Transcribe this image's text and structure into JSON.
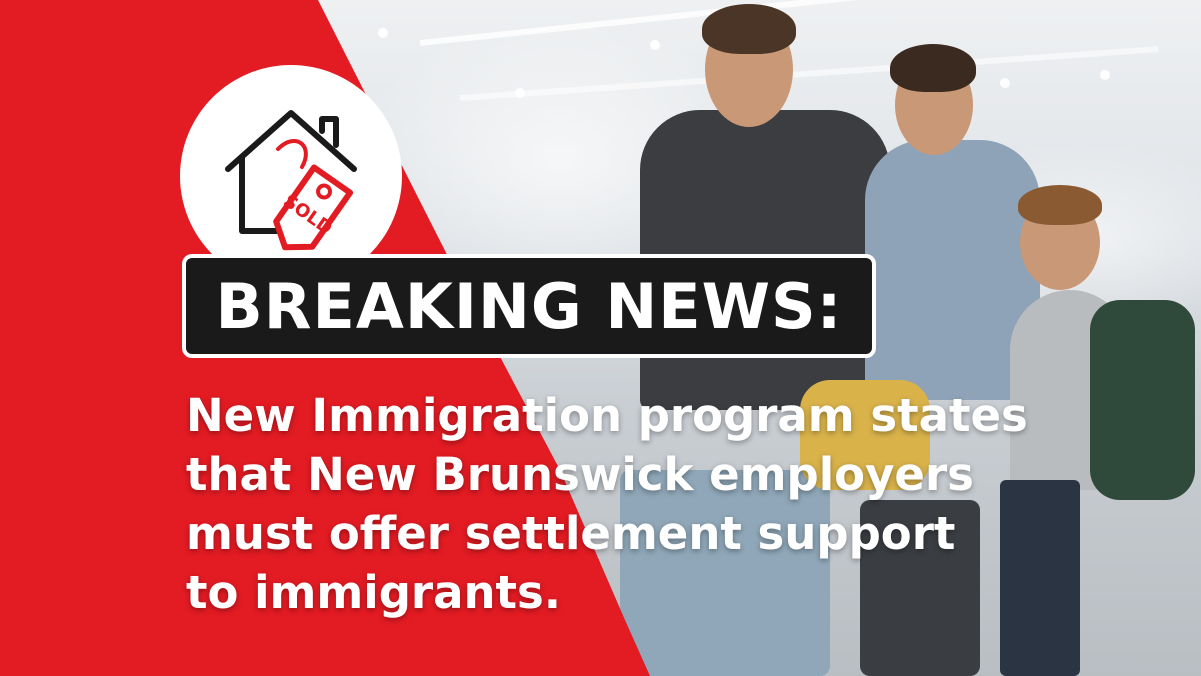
{
  "banner": {
    "title": "BREAKING NEWS:",
    "headline_lines": [
      "New Immigration program states",
      "that New Brunswick employers",
      "must offer settlement support",
      "to immigrants."
    ]
  },
  "icon": {
    "name": "house-sold-tag-icon",
    "tag_text": "SOLD"
  },
  "colors": {
    "brand_red": "#e31b23",
    "box_black": "#1a1a1a",
    "text_white": "#ffffff"
  }
}
